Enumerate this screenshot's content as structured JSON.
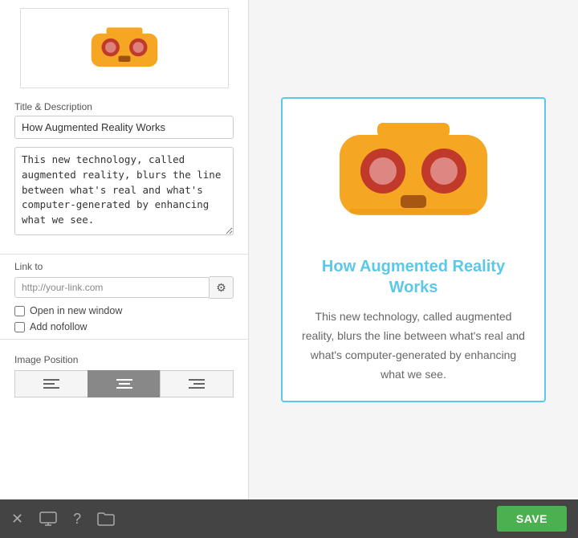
{
  "left_panel": {
    "title_label": "Title & Description",
    "title_value": "How Augmented Reality Works",
    "description_value": "This new technology, called augmented reality, blurs the line between what's real and what's computer-generated by enhancing what we see.",
    "link_label": "Link to",
    "link_placeholder": "http://your-link.com",
    "open_new_window_label": "Open in new window",
    "add_nofollow_label": "Add nofollow",
    "image_position_label": "Image Position",
    "position_buttons": [
      {
        "id": "left",
        "symbol": "☰"
      },
      {
        "id": "center",
        "symbol": "☰"
      },
      {
        "id": "right",
        "symbol": "☰"
      }
    ]
  },
  "preview": {
    "title": "How Augmented Reality Works",
    "description": "This new technology, called augmented reality, blurs the line between what's real and what's computer-generated by enhancing what we see."
  },
  "bottom_bar": {
    "save_label": "SAVE"
  },
  "colors": {
    "vr_body": "#F5A623",
    "vr_eye": "#C0392B",
    "vr_eye_inner": "#E74C3C",
    "vr_nose": "#7B2D0A",
    "preview_title": "#5BC8E8",
    "preview_border": "#5BC8E8",
    "save_bg": "#4CAF50"
  }
}
